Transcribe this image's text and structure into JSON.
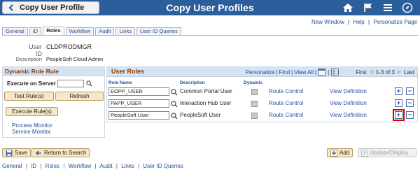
{
  "header": {
    "back_label": "Copy User Profile",
    "title": "Copy User Profiles",
    "icons": [
      "home-icon",
      "flag-icon",
      "menu-icon",
      "navbar-icon"
    ]
  },
  "toplinks": {
    "new_window": "New Window",
    "help": "Help",
    "personalize_page": "Personalize Page",
    "sep": "|"
  },
  "tabs": [
    "General",
    "ID",
    "Roles",
    "Workflow",
    "Audit",
    "Links",
    "User ID Queries"
  ],
  "user": {
    "userid_label": "User ID",
    "userid_value": "CLDPRODMGR",
    "desc_label": "Description",
    "desc_value": "PeopleSoft Cloud Admin"
  },
  "dynamic_rule": {
    "title": "Dynamic Role Rule",
    "execute_on_server_label": "Execute on Server",
    "test_rules_label": "Test Rule(s)",
    "refresh_label": "Refresh",
    "execute_rules_label": "Execute Rule(s)",
    "process_monitor": "Process Monitor",
    "service_monitor": "Service Monitor"
  },
  "user_roles": {
    "title": "User Roles",
    "nav": {
      "personalize": "Personalize",
      "find": "Find",
      "view_all": "View All",
      "first": "First",
      "range": "1-3 of 3",
      "last": "Last",
      "sep": "|"
    },
    "columns": [
      "Role Name",
      "Description",
      "Dynamic"
    ],
    "rows": [
      {
        "role": "EOPP_USER",
        "desc": "Common Portal User",
        "route": "Route Control",
        "view": "View Definition"
      },
      {
        "role": "PAPP_USER",
        "desc": "Interaction Hub User",
        "route": "Route Control",
        "view": "View Definition"
      },
      {
        "role": "PeopleSoft User",
        "desc": "PeopleSoft User",
        "route": "Route Control",
        "view": "View Definition"
      }
    ]
  },
  "bottom": {
    "save": "Save",
    "return_to_search": "Return to Search",
    "add": "Add",
    "update_display": "Update/Display"
  },
  "footer_links": [
    "General",
    "ID",
    "Roles",
    "Workflow",
    "Audit",
    "Links",
    "User ID Queries"
  ],
  "footer_sep": "|",
  "colors": {
    "banner": "#2b5f9c",
    "section_title": "#8a3a00",
    "link": "#1f4e9e",
    "button": "#f6e8c6"
  }
}
